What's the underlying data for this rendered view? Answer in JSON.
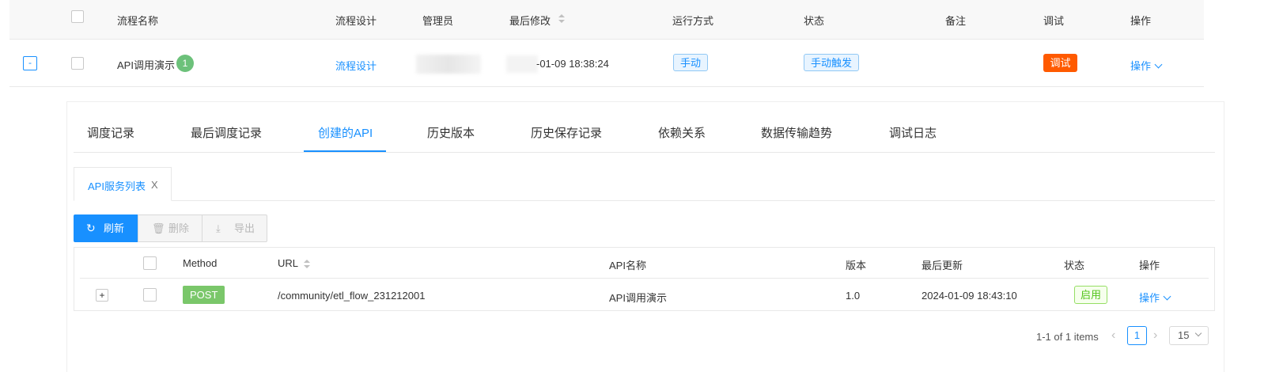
{
  "outer_table": {
    "headers": {
      "name": "流程名称",
      "design": "流程设计",
      "admin": "管理员",
      "modified": "最后修改",
      "run_mode": "运行方式",
      "status": "状态",
      "remark": "备注",
      "debug": "调试",
      "action": "操作"
    },
    "row": {
      "collapse_symbol": "-",
      "name": "API调用演示",
      "badge_count": "1",
      "design_link": "流程设计",
      "modified_visible": "-01-09 18:38:24",
      "run_mode": "手动",
      "status": "手动触发",
      "debug_button": "调试",
      "action_link": "操作"
    }
  },
  "tabs": [
    {
      "label": "调度记录",
      "active": false
    },
    {
      "label": "最后调度记录",
      "active": false
    },
    {
      "label": "创建的API",
      "active": true
    },
    {
      "label": "历史版本",
      "active": false
    },
    {
      "label": "历史保存记录",
      "active": false
    },
    {
      "label": "依赖关系",
      "active": false
    },
    {
      "label": "数据传输趋势",
      "active": false
    },
    {
      "label": "调试日志",
      "active": false
    }
  ],
  "sub_tab": {
    "label": "API服务列表",
    "close": "X"
  },
  "toolbar": {
    "refresh": "刷新",
    "delete": "删除",
    "export": "导出"
  },
  "inner_table": {
    "headers": {
      "method": "Method",
      "url": "URL",
      "api_name": "API名称",
      "version": "版本",
      "updated": "最后更新",
      "status": "状态",
      "action": "操作"
    },
    "row": {
      "expand_symbol": "+",
      "method": "POST",
      "url": "/community/etl_flow_231212001",
      "api_name": "API调用演示",
      "version": "1.0",
      "updated": "2024-01-09 18:43:10",
      "status": "启用",
      "action": "操作"
    }
  },
  "pagination": {
    "summary": "1-1 of 1 items",
    "current_page": "1",
    "page_size": "15"
  },
  "colors": {
    "primary": "#1890ff",
    "debug_button": "#ff5a00",
    "badge_green": "#6cc17a",
    "post_green": "#7ac76a",
    "enabled_green": "#52c41a"
  }
}
